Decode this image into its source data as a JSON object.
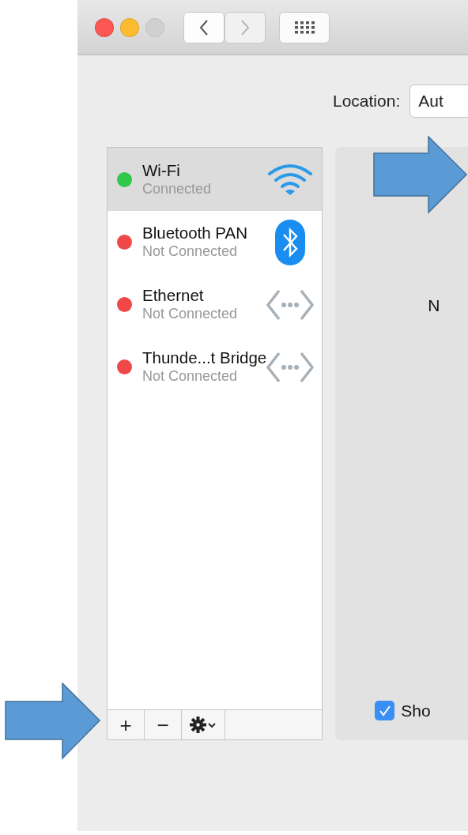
{
  "window": {
    "traffic_lights": [
      {
        "kind": "close",
        "disabled": false
      },
      {
        "kind": "minimize",
        "disabled": false
      },
      {
        "kind": "zoom",
        "disabled": true
      }
    ],
    "nav_buttons": [
      {
        "kind": "back",
        "disabled": false
      },
      {
        "kind": "forward",
        "disabled": true
      }
    ]
  },
  "location": {
    "label": "Location:",
    "value": "Aut"
  },
  "services": [
    {
      "name": "Wi-Fi",
      "status": "Connected",
      "color": "#2fc84a",
      "kind": "wifi",
      "selected": true
    },
    {
      "name": "Bluetooth PAN",
      "status": "Not Connected",
      "color": "#f04848",
      "kind": "bluetooth",
      "selected": false
    },
    {
      "name": "Ethernet",
      "status": "Not Connected",
      "color": "#f04848",
      "kind": "ethernet",
      "selected": false
    },
    {
      "name": "Thunde...t Bridge",
      "status": "Not Connected",
      "color": "#f04848",
      "kind": "ethernet",
      "selected": false
    }
  ],
  "list_toolbar": [
    {
      "kind": "text",
      "label": "+"
    },
    {
      "kind": "text",
      "label": "−"
    },
    {
      "kind": "gear"
    }
  ],
  "detail": {
    "partial_text": "N",
    "checkbox": {
      "label": "Sho",
      "checked": true
    }
  }
}
